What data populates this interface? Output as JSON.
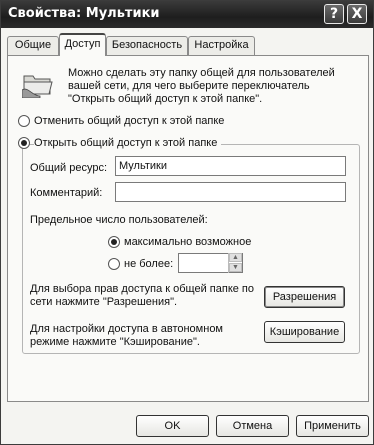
{
  "window": {
    "title": "Свойства: Мультики",
    "help_label": "?",
    "close_label": "X"
  },
  "tabs": [
    {
      "label": "Общие"
    },
    {
      "label": "Доступ"
    },
    {
      "label": "Безопасность"
    },
    {
      "label": "Настройка"
    }
  ],
  "sharing": {
    "intro_text": "Можно сделать эту папку общей для пользователей вашей сети, для чего выберите переключатель \"Открыть общий доступ к этой папке\".",
    "do_not_share_label": "Отменить общий доступ к этой папке",
    "share_label": "Открыть общий доступ к этой папке",
    "share_name_label": "Общий ресурс:",
    "share_name_value": "Мультики",
    "comment_label": "Комментарий:",
    "comment_value": "",
    "user_limit_label": "Предельное число пользователей:",
    "max_allowed_label": "максимально возможное",
    "allow_label": "не более:",
    "allow_value": "",
    "permissions_text": "Для выбора прав доступа к общей папке по сети нажмите \"Разрешения\".",
    "permissions_button": "Разрешения",
    "caching_text": "Для настройки доступа в автономном режиме нажмите \"Кэширование\".",
    "caching_button": "Кэширование"
  },
  "footer": {
    "ok_label": "OK",
    "cancel_label": "Отмена",
    "apply_label": "Применить"
  },
  "icons": {
    "folder": "shared-folder-icon",
    "spin_up": "spin-up-icon",
    "spin_down": "spin-down-icon"
  }
}
